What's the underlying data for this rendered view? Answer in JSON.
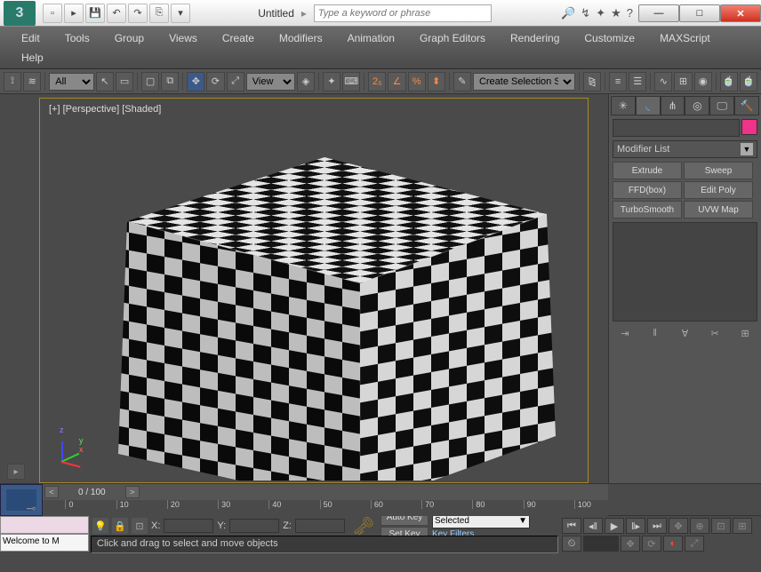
{
  "window": {
    "title": "Untitled"
  },
  "search": {
    "placeholder": "Type a keyword or phrase"
  },
  "menu": [
    "Edit",
    "Tools",
    "Group",
    "Views",
    "Create",
    "Modifiers",
    "Animation",
    "Graph Editors",
    "Rendering",
    "Customize",
    "MAXScript",
    "Help"
  ],
  "toolbar": {
    "filter": "All",
    "refsys": "View",
    "named_sel": "Create Selection Se"
  },
  "viewport": {
    "label": "[+] [Perspective] [Shaded]",
    "axes": {
      "x": "x",
      "y": "y",
      "z": "z"
    }
  },
  "panel": {
    "modifier_list": "Modifier List",
    "buttons": [
      "Extrude",
      "Sweep",
      "FFD(box)",
      "Edit Poly",
      "TurboSmooth",
      "UVW Map"
    ]
  },
  "timeline": {
    "frame": "0 / 100",
    "ticks": [
      0,
      10,
      20,
      30,
      40,
      50,
      60,
      70,
      80,
      90,
      100
    ]
  },
  "bottom": {
    "status": "Welcome to M",
    "prompt": "Click and drag to select and move objects",
    "xl": "X:",
    "yl": "Y:",
    "zl": "Z:",
    "autokey": "Auto Key",
    "setkey": "Set Key",
    "selected": "Selected",
    "keyfilter": "Key Filters..."
  }
}
